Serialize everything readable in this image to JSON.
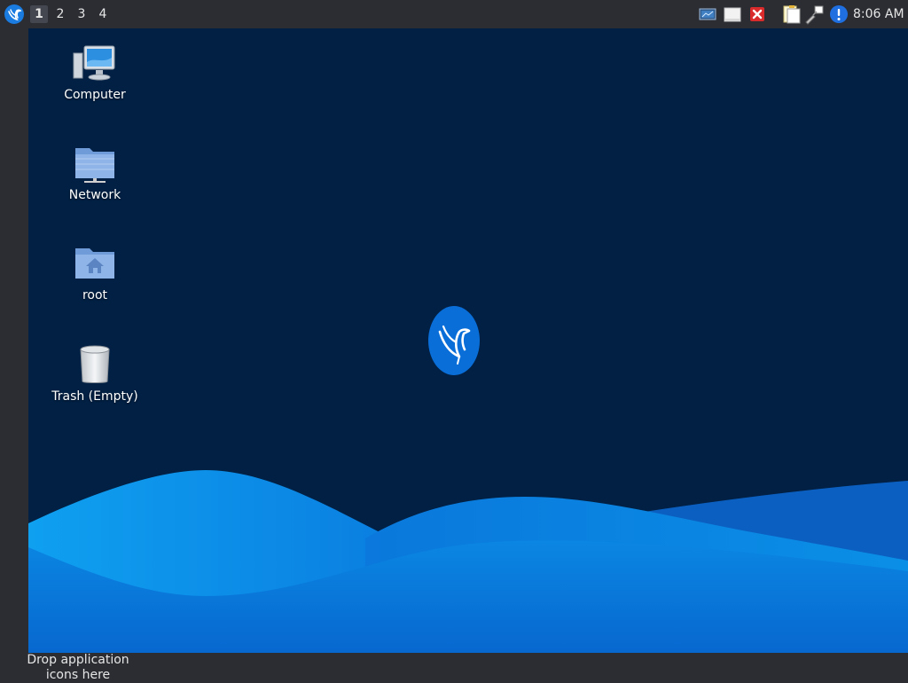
{
  "taskbar": {
    "menu_icon": "lxqt-bird-icon",
    "workspaces": [
      "1",
      "2",
      "3",
      "4"
    ],
    "active_workspace": "1",
    "tray_icons": [
      "network-display-icon",
      "clipboard-blank-icon",
      "close-error-icon",
      "notes-icon",
      "pen-tablet-icon",
      "info-alert-icon"
    ],
    "clock": "8:06 AM"
  },
  "desktop": {
    "icons": [
      {
        "label": "Computer",
        "icon": "computer-icon"
      },
      {
        "label": "Network",
        "icon": "network-folder-icon"
      },
      {
        "label": "root",
        "icon": "home-folder-icon"
      },
      {
        "label": "Trash (Empty)",
        "icon": "trash-icon"
      }
    ],
    "logo": "hummingbird-logo-icon",
    "colors": {
      "background": "#012044",
      "wave_light": "#0a8fe6",
      "wave_dark": "#0865c8",
      "panel": "#2b2d33"
    }
  },
  "quicklaunch": {
    "hint": "Drop application icons here"
  }
}
